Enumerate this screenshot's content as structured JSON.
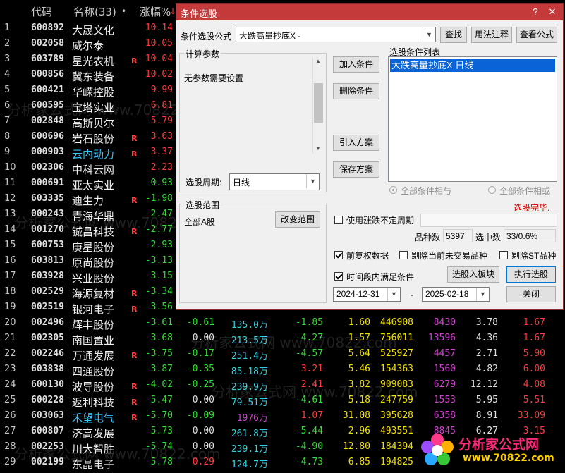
{
  "table": {
    "headers": {
      "code": "代码",
      "name": "名称(33)",
      "dot": "•",
      "change": "涨幅%",
      "sort": "↓"
    },
    "rows": [
      {
        "no": "1",
        "code": "600892",
        "name": "大晟文化",
        "r": "",
        "pct": "10.14"
      },
      {
        "no": "2",
        "code": "002058",
        "name": "威尔泰",
        "r": "",
        "pct": "10.05"
      },
      {
        "no": "3",
        "code": "603789",
        "name": "星光农机",
        "r": "R",
        "pct": "10.04"
      },
      {
        "no": "4",
        "code": "000856",
        "name": "冀东装备",
        "r": "",
        "pct": "10.02"
      },
      {
        "no": "5",
        "code": "600421",
        "name": "华嵘控股",
        "r": "",
        "pct": "9.99"
      },
      {
        "no": "6",
        "code": "600595",
        "name": "宝塔实业",
        "r": "",
        "pct": "6.81"
      },
      {
        "no": "7",
        "code": "002848",
        "name": "高斯贝尔",
        "r": "",
        "pct": "5.79"
      },
      {
        "no": "8",
        "code": "600696",
        "name": "岩石股份",
        "r": "R",
        "pct": "3.63"
      },
      {
        "no": "9",
        "code": "000903",
        "name": "云内动力",
        "r": "R",
        "pct": "3.37",
        "alt": true
      },
      {
        "no": "10",
        "code": "002306",
        "name": "中科云网",
        "r": "",
        "pct": "2.23"
      },
      {
        "no": "11",
        "code": "000691",
        "name": "亚太实业",
        "r": "",
        "pct": "-0.93"
      },
      {
        "no": "12",
        "code": "603335",
        "name": "迪生力",
        "r": "R",
        "pct": "-1.98"
      },
      {
        "no": "13",
        "code": "000243",
        "name": "青海华鼎",
        "r": "",
        "pct": "-2.47"
      },
      {
        "no": "14",
        "code": "001270",
        "name": "铖昌科技",
        "r": "R",
        "pct": "-2.77"
      },
      {
        "no": "15",
        "code": "600753",
        "name": "庚星股份",
        "r": "",
        "pct": "-2.93"
      },
      {
        "no": "16",
        "code": "603813",
        "name": "原尚股份",
        "r": "",
        "pct": "-3.13"
      },
      {
        "no": "17",
        "code": "603928",
        "name": "兴业股份",
        "r": "",
        "pct": "-3.15"
      },
      {
        "no": "18",
        "code": "002529",
        "name": "海源复材",
        "r": "R",
        "pct": "-3.34"
      },
      {
        "no": "19",
        "code": "002519",
        "name": "银河电子",
        "r": "R",
        "pct": "-3.56"
      },
      {
        "no": "20",
        "code": "002496",
        "name": "辉丰股份",
        "r": "",
        "pct": "-3.61",
        "spd": "-0.61",
        "vol": "135.0万",
        "f5": "-1.85",
        "f6": "1.60",
        "f7": "446908",
        "f8": "8430",
        "f9": "3.78",
        "f10": "1.67"
      },
      {
        "no": "21",
        "code": "002305",
        "name": "南国置业",
        "r": "",
        "pct": "-3.68",
        "spd": "0.00",
        "vol": "213.5万",
        "f5": "-4.27",
        "f6": "1.57",
        "f7": "756011",
        "f8": "13596",
        "f9": "4.36",
        "f10": "1.67"
      },
      {
        "no": "22",
        "code": "002246",
        "name": "万通发展",
        "r": "R",
        "pct": "-3.75",
        "spd": "-0.17",
        "vol": "251.4万",
        "f5": "-4.57",
        "f6": "5.64",
        "f7": "525927",
        "f8": "4457",
        "f9": "2.71",
        "f10": "5.90"
      },
      {
        "no": "23",
        "code": "603838",
        "name": "四通股份",
        "r": "",
        "pct": "-3.87",
        "spd": "-0.35",
        "vol": "85.18万",
        "f5": "3.21",
        "f6": "5.46",
        "f7": "154363",
        "f8": "1560",
        "f9": "4.82",
        "f10": "6.00"
      },
      {
        "no": "24",
        "code": "600130",
        "name": "波导股份",
        "r": "R",
        "pct": "-4.02",
        "spd": "-0.25",
        "vol": "239.9万",
        "f5": "2.41",
        "f6": "3.82",
        "f7": "909083",
        "f8": "6279",
        "f9": "12.12",
        "f10": "4.08"
      },
      {
        "no": "25",
        "code": "600228",
        "name": "返利科技",
        "r": "R",
        "pct": "-5.47",
        "spd": "0.00",
        "vol": "79.51万",
        "f5": "-4.61",
        "f6": "5.18",
        "f7": "247759",
        "f8": "1553",
        "f9": "5.95",
        "f10": "5.51"
      },
      {
        "no": "26",
        "code": "603063",
        "name": "禾望电气",
        "r": "R",
        "pct": "-5.70",
        "spd": "-0.09",
        "vol": "1976万",
        "f5": "1.07",
        "f6": "31.08",
        "f7": "395628",
        "f8": "6358",
        "f9": "8.91",
        "f10": "33.09",
        "alt": true
      },
      {
        "no": "27",
        "code": "600807",
        "name": "济高发展",
        "r": "",
        "pct": "-5.73",
        "spd": "0.00",
        "vol": "261.8万",
        "f5": "-5.44",
        "f6": "2.96",
        "f7": "493551",
        "f8": "8845",
        "f9": "6.27",
        "f10": "3.15"
      },
      {
        "no": "28",
        "code": "002253",
        "name": "川大智胜",
        "r": "",
        "pct": "-5.74",
        "spd": "0.00",
        "vol": "239.1万",
        "f5": "-4.90",
        "f6": "12.80",
        "f7": "184394",
        "f8": "",
        "f9": "",
        "f10": ""
      },
      {
        "no": "29",
        "code": "002199",
        "name": "东晶电子",
        "r": "",
        "pct": "-5.78",
        "spd": "0.29",
        "vol": "124.7万",
        "f5": "-4.73",
        "f6": "6.85",
        "f7": "194825",
        "f8": "",
        "f9": "",
        "f10": ""
      }
    ]
  },
  "dialog": {
    "title": "条件选股",
    "formula_label": "条件选股公式",
    "formula_value": "大跌高量抄底X  -",
    "find_btn": "查找",
    "usage_btn": "用法注释",
    "view_btn": "查看公式",
    "calc_group": "计算参数",
    "calc_text": "无参数需要设置",
    "period_label": "选股周期:",
    "period_value": "日线",
    "add_btn": "加入条件",
    "del_btn": "删除条件",
    "import_btn": "引入方案",
    "save_btn": "保存方案",
    "list_title": "选股条件列表",
    "list_item": "大跌高量抄底X  日线",
    "radio_and": "全部条件相与",
    "radio_or": "全部条件相或",
    "done_text": "选股完毕.",
    "range_group": "选股范围",
    "range_value": "全部A股",
    "change_range_btn": "改变范围",
    "use_uncertain": "使用涨跌不定周期",
    "count_label": "品种数",
    "count_value": "5397",
    "selected_label": "选中数",
    "selected_value": "33/0.6%",
    "pre_adjust": "前复权数据",
    "exclude_untraded": "剔除当前未交易品种",
    "exclude_st": "剔除ST品种",
    "time_cond": "时间段内满足条件",
    "to_block_btn": "选股入板块",
    "run_btn": "执行选股",
    "date_start": "2024-12-31",
    "date_sep": "-",
    "date_end": "2025-02-18",
    "close_btn": "关闭",
    "help_icon": "?",
    "close_icon": "✕"
  },
  "watermarks": [
    "分析家公式网 www.70822.com"
  ],
  "logo": {
    "title": "分析家公式网",
    "url": "www.70822.com"
  },
  "colors": {
    "up": "#ff3b3b",
    "down": "#33dd33",
    "title_bar": "#c43a3a",
    "selection": "#0a64d8"
  }
}
